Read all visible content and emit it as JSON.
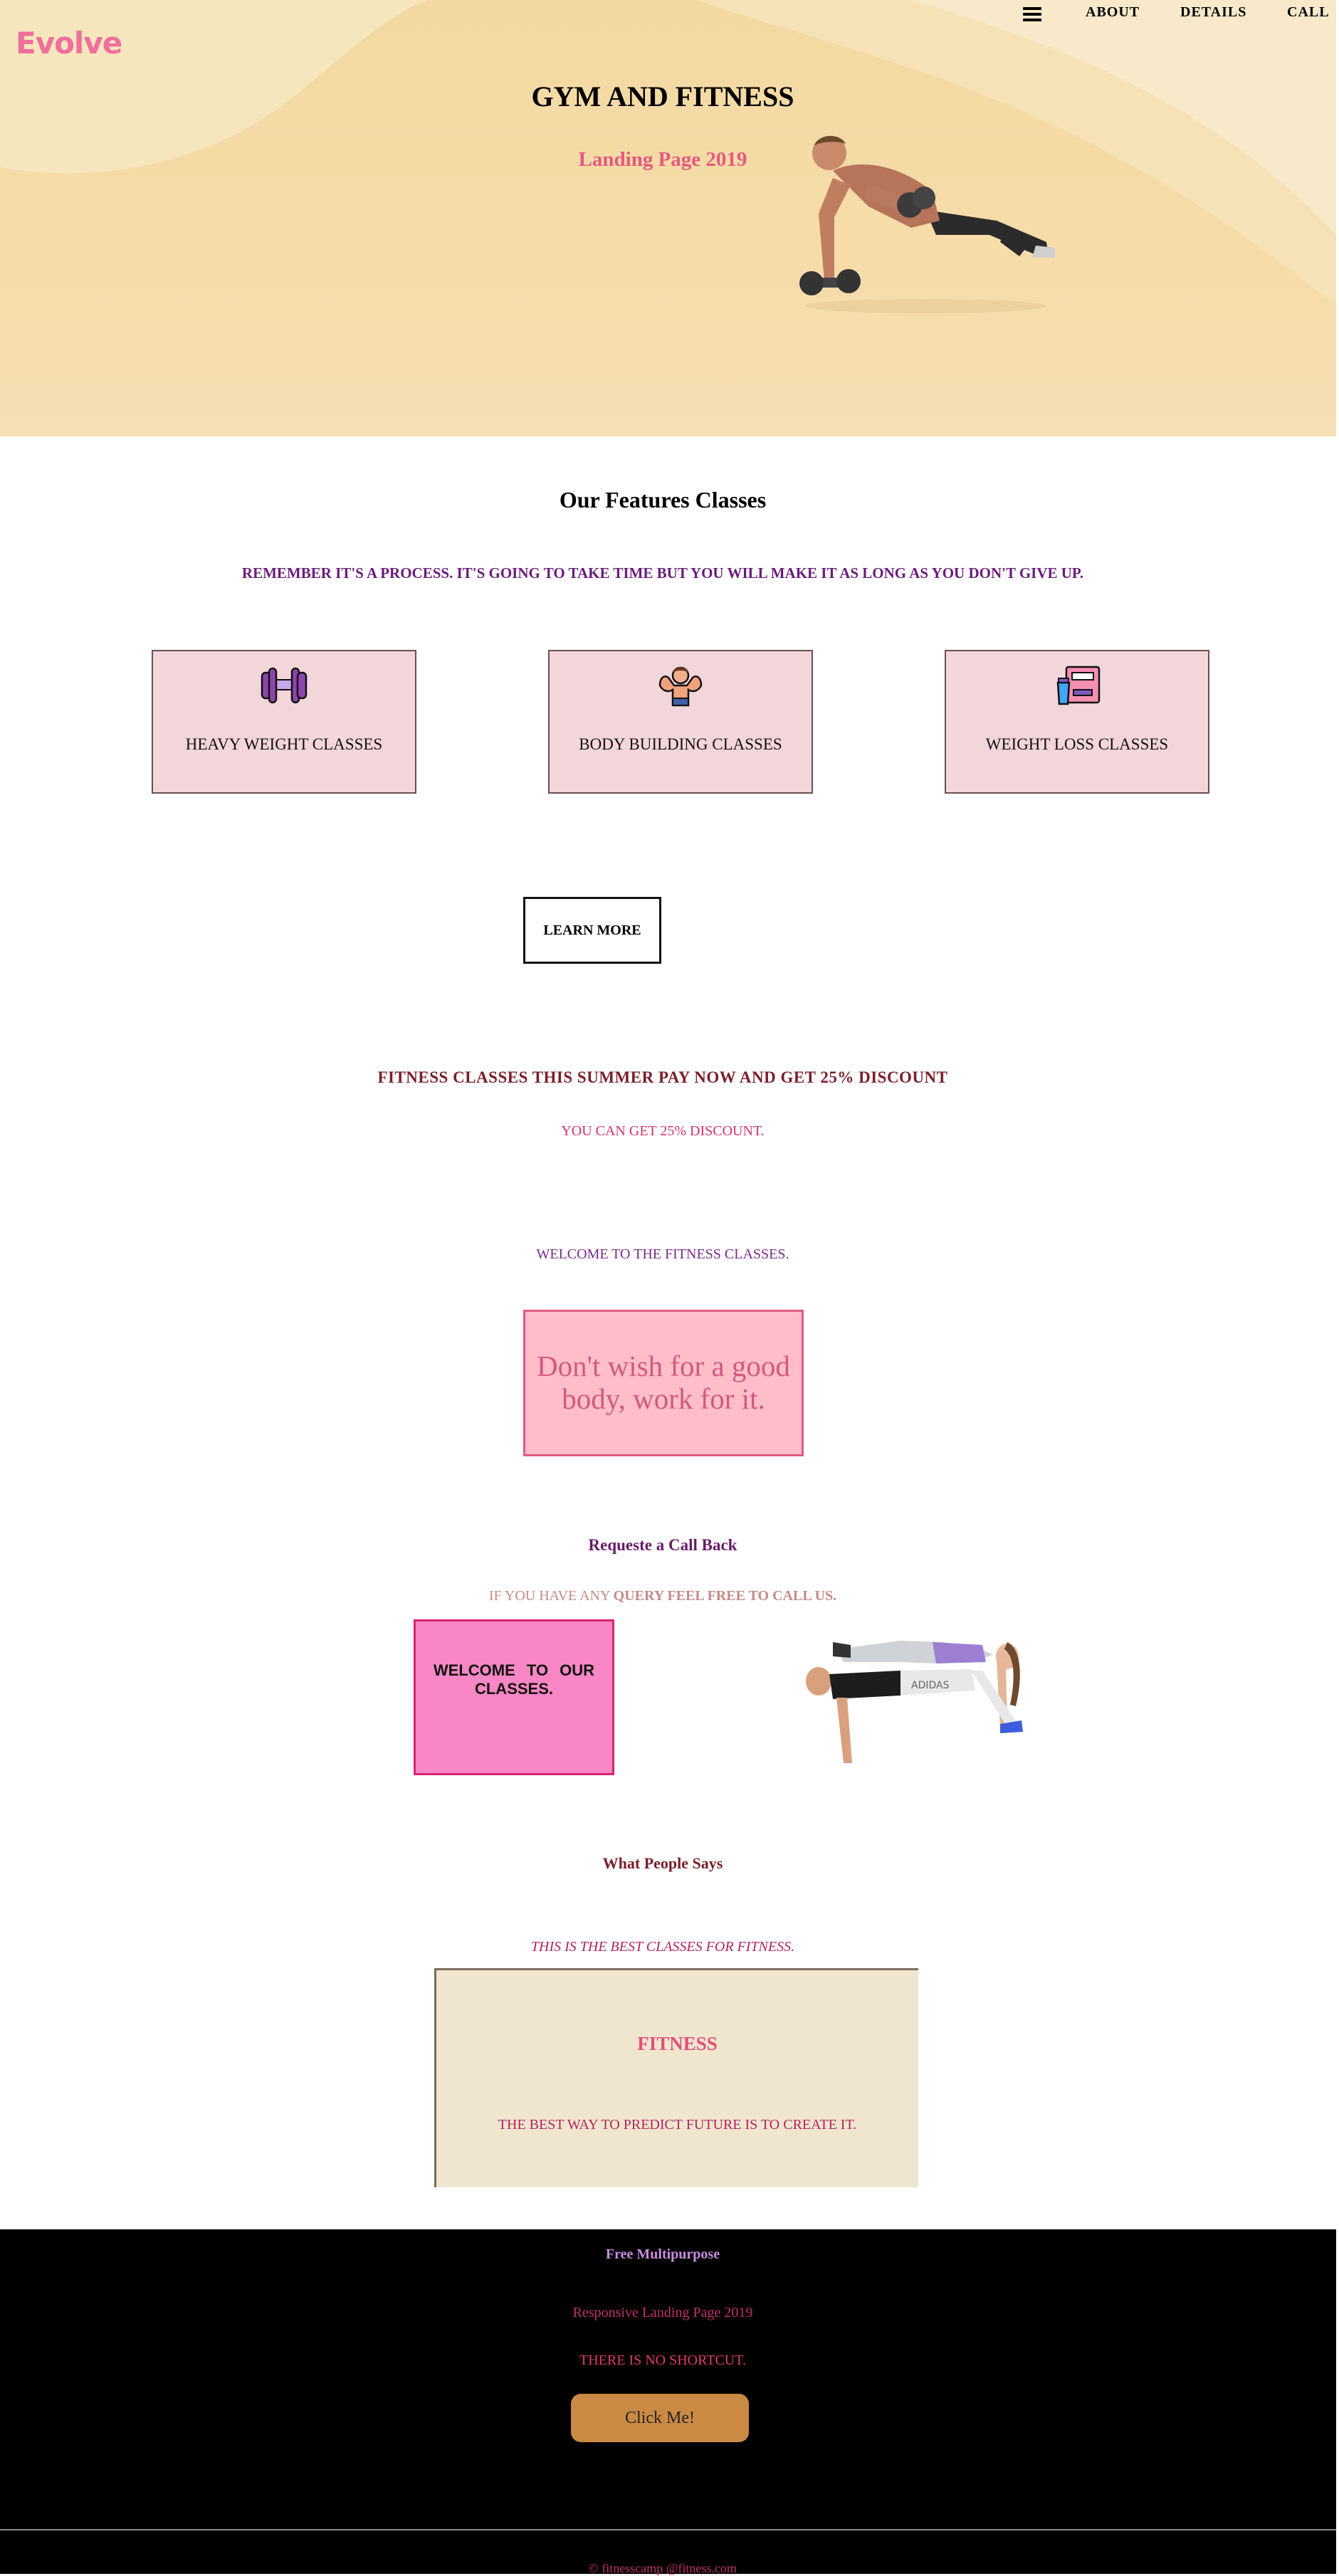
{
  "header": {
    "logo": "Evolve",
    "nav": [
      "ABOUT",
      "DETAILS",
      "CALL"
    ]
  },
  "hero": {
    "title": "GYM AND FITNESS",
    "subtitle": "Landing Page 2019"
  },
  "features": {
    "title": "Our Features Classes",
    "tagline": "REMEMBER IT'S A PROCESS. IT'S GOING TO TAKE TIME BUT YOU WILL MAKE IT AS LONG AS YOU DON'T GIVE UP.",
    "cards": [
      {
        "label": "HEAVY WEIGHT CLASSES",
        "icon": "dumbbell-icon"
      },
      {
        "label": "BODY BUILDING CLASSES",
        "icon": "bodybuilder-icon"
      },
      {
        "label": "WEIGHT LOSS CLASSES",
        "icon": "weight-scale-icon"
      }
    ],
    "learn_more": "LEARN MORE"
  },
  "discount": {
    "headline": "FITNESS CLASSES THIS SUMMER PAY NOW AND GET 25% DISCOUNT",
    "sub": "YOU CAN GET 25% DISCOUNT."
  },
  "welcome": {
    "text": "WELCOME TO THE FITNESS CLASSES.",
    "quote": "Don't wish for a good body, work for it."
  },
  "callback": {
    "title": "Requeste a Call Back",
    "line_plain": "IF YOU HAVE ANY",
    "line_bold": "QUERY FEEL FREE TO CALL US.",
    "box": "WELCOME TO OUR CLASSES."
  },
  "testimonials": {
    "title": "What People Says",
    "tagline": "THIS IS THE BEST CLASSES FOR FITNESS.",
    "card_title": "FITNESS",
    "card_text": "THE BEST WAY TO PREDICT FUTURE IS TO CREATE IT."
  },
  "footer": {
    "title": "Free Multipurpose",
    "sub": "Responsive Landing Page 2019",
    "tagline": "THERE IS NO SHORTCUT.",
    "button": "Click Me!",
    "copyright": "© fitnesscamp @fitness.com"
  },
  "colors": {
    "logo": "#ef6f9d",
    "accent_pink": "#e5597f",
    "purple": "#6a1b7a",
    "maroon": "#7a1f2a",
    "card_bg": "#f3d6da",
    "footer_bg": "#000000",
    "button_orange": "#cb8a43"
  }
}
